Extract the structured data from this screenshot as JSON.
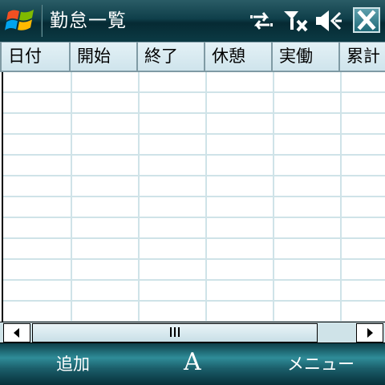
{
  "titlebar": {
    "title": "勤怠一覧",
    "icons": [
      "windows-start-icon",
      "connectivity-icon",
      "no-signal-icon",
      "speaker-icon",
      "close-icon"
    ]
  },
  "grid": {
    "columns": [
      "日付",
      "開始",
      "終了",
      "休憩",
      "実働",
      "累計"
    ],
    "rows": []
  },
  "scrollbar": {
    "grip_icon": "grip-icon"
  },
  "softkeys": {
    "left": "追加",
    "center": "A",
    "right": "メニュー"
  },
  "colors": {
    "titlebar": "#0f3f4a",
    "header": "#cfe4ec",
    "gridline": "#cfe3e8",
    "softbar": "#2f8c98"
  }
}
